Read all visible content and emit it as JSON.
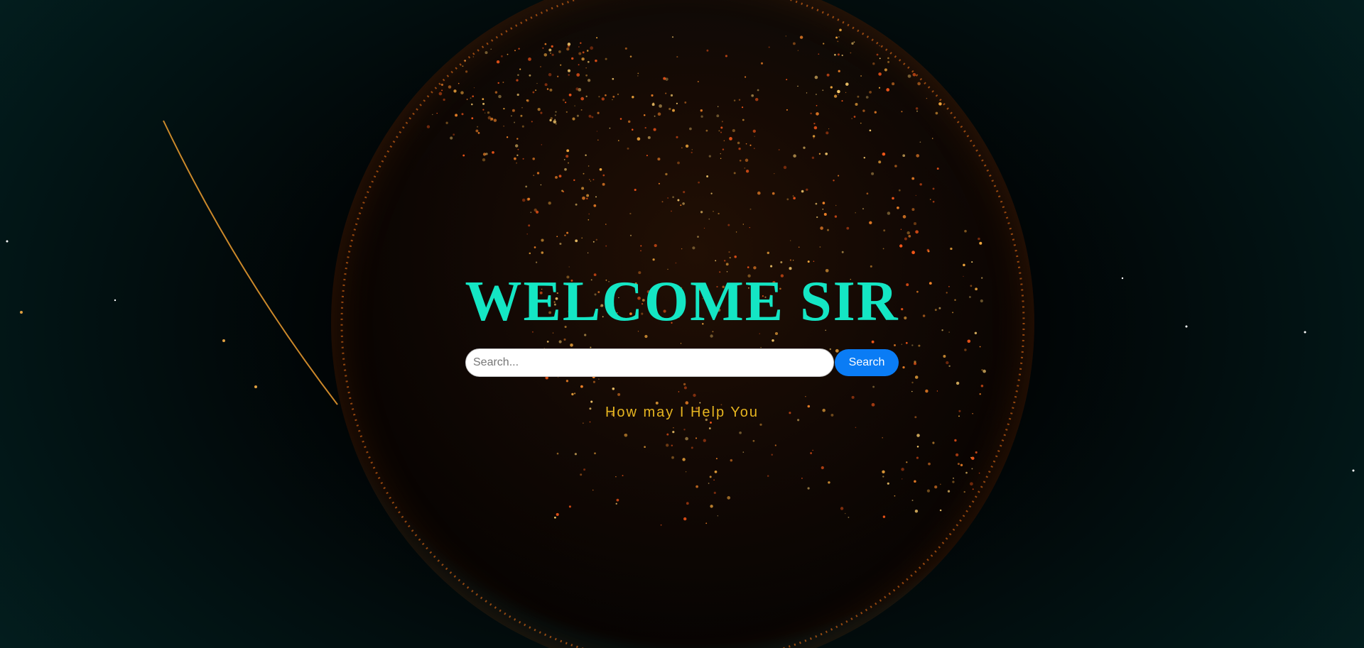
{
  "hero": {
    "title": "WELCOME SIR",
    "tagline": "How may I Help You"
  },
  "search": {
    "placeholder": "Search...",
    "value": "",
    "button_label": "Search"
  },
  "colors": {
    "title": "#14e6c4",
    "tagline": "#e6b520",
    "button": "#0a7cf5",
    "background": "#010304",
    "globe_lights": "#ff7a1a"
  },
  "background_image": {
    "subject": "earth-globe-city-lights"
  }
}
